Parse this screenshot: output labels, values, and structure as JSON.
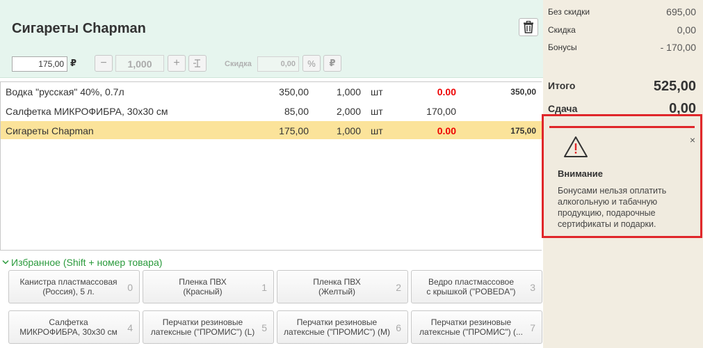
{
  "product": {
    "title": "Сигареты Chapman",
    "price_value": "175,00",
    "currency": "₽",
    "quantity_value": "1,000",
    "discount_label": "Скидка",
    "discount_value": "0,00",
    "percent_symbol": "%",
    "ruble_symbol": "₽"
  },
  "items": [
    {
      "name": "Водка \"русская\" 40%, 0.7л",
      "price": "350,00",
      "qty": "1,000",
      "unit": "шт",
      "discount": "0.00",
      "sum": "350,00"
    },
    {
      "name": "Салфетка МИКРОФИБРА, 30x30 см",
      "price": "85,00",
      "qty": "2,000",
      "unit": "шт",
      "discount": "170,00",
      "sum": ""
    },
    {
      "name": "Сигареты Chapman",
      "price": "175,00",
      "qty": "1,000",
      "unit": "шт",
      "discount": "0.00",
      "sum": "175,00"
    }
  ],
  "favorites": {
    "header": "Избранное (Shift + номер товара)",
    "items": [
      {
        "line1": "Канистра пластмассовая",
        "line2": "(Россия), 5 л.",
        "num": "0"
      },
      {
        "line1": "Пленка ПВХ",
        "line2": "(Красный)",
        "num": "1"
      },
      {
        "line1": "Пленка ПВХ",
        "line2": "(Желтый)",
        "num": "2"
      },
      {
        "line1": "Ведро пластмассовое",
        "line2": "с крышкой (\"POBEDA\")",
        "num": "3"
      },
      {
        "line1": "Салфетка",
        "line2": "МИКРОФИБРА, 30x30 см",
        "num": "4"
      },
      {
        "line1": "Перчатки резиновые",
        "line2": "латексные (\"ПРОМИС\") (L)",
        "num": "5"
      },
      {
        "line1": "Перчатки резиновые",
        "line2": "латексные (\"ПРОМИС\") (M)",
        "num": "6"
      },
      {
        "line1": "Перчатки резиновые",
        "line2": "латексные (\"ПРОМИС\") (...",
        "num": "7"
      }
    ]
  },
  "summary": {
    "no_discount_label": "Без скидки",
    "no_discount_value": "695,00",
    "discount_label": "Скидка",
    "discount_value": "0,00",
    "bonus_label": "Бонусы",
    "bonus_value": "- 170,00",
    "total_label": "Итого",
    "total_value": "525,00",
    "change_label": "Сдача",
    "change_value": "0,00"
  },
  "popup": {
    "title": "Внимание",
    "text": "Бонусами нельзя оплатить алкогольную и табачную продукцию, подарочные сертификаты и подарки.",
    "close": "×"
  },
  "colors": {
    "header_bg": "#e6f5ee",
    "selected_row": "#fbe39a",
    "discount_red": "#e00000",
    "favorites_green": "#2a9a3c",
    "panel_bg": "#f2ede1",
    "alert_border": "#e0262a"
  }
}
